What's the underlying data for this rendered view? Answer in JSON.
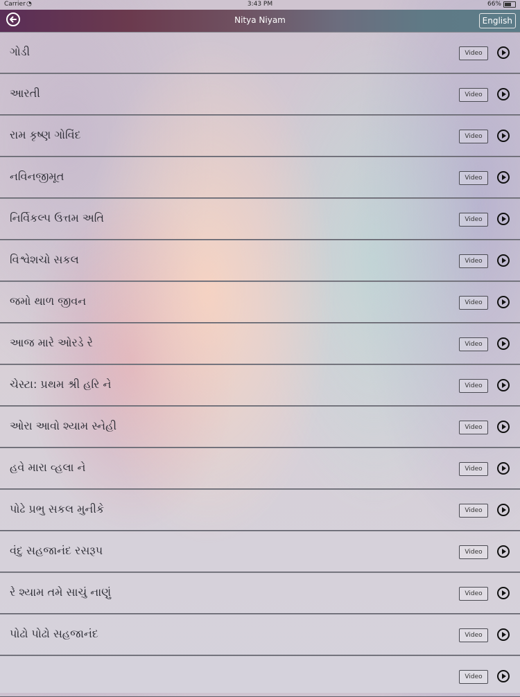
{
  "statusbar": {
    "carrier": "Carrier",
    "time": "3:43 PM",
    "battery": "66%"
  },
  "navbar": {
    "title": "Nitya Niyam",
    "language_button": "English"
  },
  "video_label": "Video",
  "items": [
    {
      "label": "ગોડી"
    },
    {
      "label": "આરતી"
    },
    {
      "label": "રામ કૃષ્ણ ગોવિંદ"
    },
    {
      "label": "નવિનજીમૂત"
    },
    {
      "label": "નિર્વિકલ્પ ઉત્તમ અતિ"
    },
    {
      "label": "વિશ્વેશચો સકલ"
    },
    {
      "label": "જમો થાળ જીવન"
    },
    {
      "label": "આજ મારે ઓરડે રે"
    },
    {
      "label": "ચેસ્ટા: પ્રથમ શ્રી હરિ ને"
    },
    {
      "label": "ઓરા આવો શ્યામ સ્નેહી"
    },
    {
      "label": "હવે મારા વ્હલા ને"
    },
    {
      "label": "પોઢે પ્રભુ સકલ મુનીકે"
    },
    {
      "label": "વંદુ સહજાનંદ રસરૂપ"
    },
    {
      "label": "રે શ્યામ તમે સાચું નાણું"
    },
    {
      "label": "પોઢો પોઢો સહજાનંદ"
    },
    {
      "label": ""
    }
  ]
}
